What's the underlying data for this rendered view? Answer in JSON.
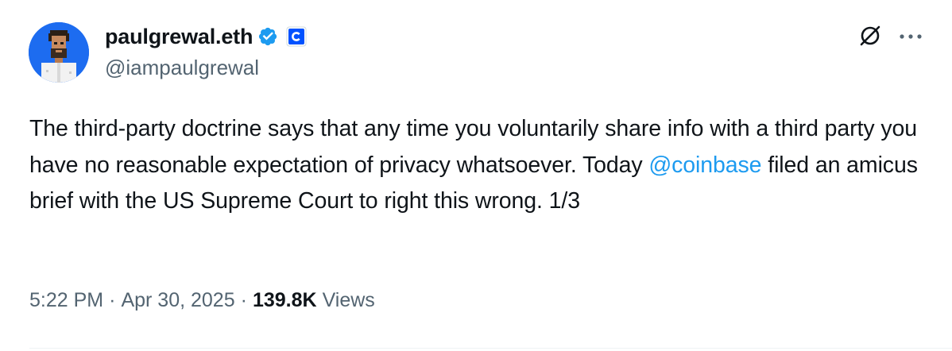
{
  "author": {
    "display_name": "paulgrewal.eth",
    "handle": "@iampaulgrewal",
    "verified_badge": "verified-check-icon",
    "affiliation_badge": "coinbase-logo-icon"
  },
  "post": {
    "text_before_mention": "The third-party doctrine says that any time you voluntarily share info with a third party you have no reasonable expectation of privacy whatsoever. Today ",
    "mention": "@coinbase",
    "text_after_mention": " filed an amicus brief with the US Supreme Court to right this wrong. 1/3"
  },
  "meta": {
    "time": "5:22 PM",
    "separator": "·",
    "date": "Apr 30, 2025",
    "views_count": "139.8K",
    "views_label": "Views"
  },
  "icons": {
    "grok": "grok-icon",
    "more": "more-options-icon"
  },
  "colors": {
    "text": "#0f1419",
    "secondary": "#536471",
    "link": "#1d9bf0",
    "verified": "#1d9bf0",
    "coinbase": "#0052ff",
    "avatar_bg": "#1d6cf0"
  }
}
